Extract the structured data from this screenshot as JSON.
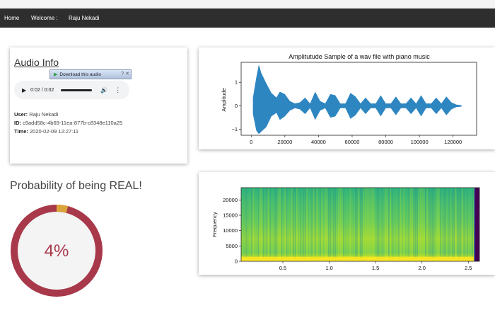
{
  "nav": {
    "home": "Home",
    "welcome": "Welcome :",
    "user": "Raju Nekadi"
  },
  "audio_info": {
    "title": "Audio Info",
    "download_label": "Download this audio",
    "player_time": "0:02 / 0:02",
    "user_label": "User:",
    "user_value": "Raju Nekadi",
    "id_label": "ID:",
    "id_value": "c9add58c-4b69-11ea-877b-c8348e110a25",
    "time_label": "Time:",
    "time_value": "2020-02-09 12:27:11"
  },
  "probability": {
    "title": "Probability of being REAL!",
    "value_text": "4%",
    "value": 0.04,
    "ring_color": "#a8394a",
    "accent_color": "#dba43b",
    "inner_color": "#f4f4f4"
  },
  "chart_data": [
    {
      "type": "line",
      "title": "Amplitutude Sample of a wav file with piano music",
      "ylabel": "Amplitude",
      "xlabel": "",
      "xlim": [
        -6000,
        134000
      ],
      "ylim": [
        -1.25,
        1.85
      ],
      "x_ticks": [
        0,
        20000,
        40000,
        60000,
        80000,
        100000,
        120000
      ],
      "y_ticks": [
        -1,
        0,
        1
      ],
      "color": "#2e86c1",
      "envelope": {
        "x": [
          1000,
          3000,
          4500,
          6000,
          9000,
          12000,
          15000,
          17000,
          20000,
          23000,
          26000,
          29000,
          32000,
          35000,
          38000,
          41000,
          44000,
          47000,
          50000,
          53000,
          56000,
          59000,
          62000,
          65000,
          68000,
          71000,
          74000,
          77000,
          80000,
          83000,
          86000,
          89000,
          92000,
          95000,
          98000,
          101000,
          104000,
          107000,
          110000,
          113000,
          116000,
          119000,
          122000,
          125000
        ],
        "upper": [
          0.35,
          1.2,
          1.75,
          1.4,
          0.95,
          0.55,
          0.35,
          0.6,
          0.5,
          0.2,
          0.1,
          0.15,
          0.35,
          0.1,
          0.6,
          0.2,
          0.1,
          0.5,
          0.45,
          0.1,
          0.1,
          0.55,
          0.4,
          0.1,
          0.35,
          0.1,
          0.1,
          0.45,
          0.1,
          0.1,
          0.4,
          0.1,
          0.1,
          0.35,
          0.1,
          0.45,
          0.1,
          0.1,
          0.35,
          0.1,
          0.4,
          0.15,
          0.05,
          0.03
        ],
        "lower": [
          -0.35,
          -1.05,
          -1.2,
          -1.1,
          -0.9,
          -0.45,
          -0.3,
          -0.6,
          -0.45,
          -0.2,
          -0.1,
          -0.15,
          -0.35,
          -0.1,
          -0.6,
          -0.2,
          -0.1,
          -0.5,
          -0.45,
          -0.1,
          -0.1,
          -0.55,
          -0.4,
          -0.1,
          -0.35,
          -0.1,
          -0.1,
          -0.45,
          -0.1,
          -0.1,
          -0.4,
          -0.1,
          -0.1,
          -0.35,
          -0.1,
          -0.45,
          -0.1,
          -0.1,
          -0.35,
          -0.1,
          -0.4,
          -0.15,
          -0.05,
          -0.03
        ]
      }
    },
    {
      "type": "heatmap",
      "title": "",
      "ylabel": "Frequency",
      "xlabel": "",
      "xlim": [
        0.05,
        2.62
      ],
      "ylim": [
        0,
        24000
      ],
      "x_ticks": [
        0.5,
        1.0,
        1.5,
        2.0,
        2.5
      ],
      "y_ticks": [
        0,
        5000,
        10000,
        15000,
        20000
      ],
      "colormap": [
        "#440154",
        "#3b528b",
        "#21918c",
        "#5ec962",
        "#aadc32",
        "#fde725"
      ]
    }
  ]
}
